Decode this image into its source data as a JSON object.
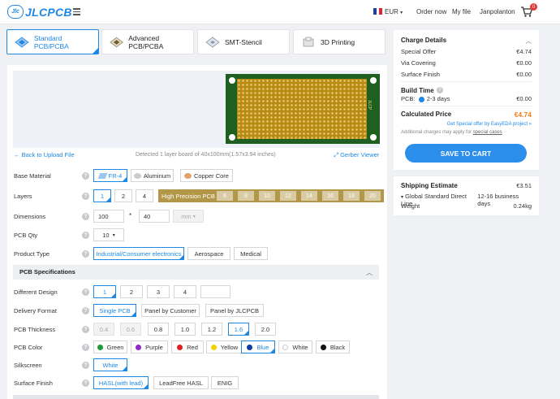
{
  "header": {
    "logo_badge": "Jlc",
    "logo_text": "JLCPCB",
    "currency": "EUR",
    "order_now": "Order now",
    "my_file": "My file",
    "username": "Janpolanton",
    "cart_count": "0"
  },
  "tabs": [
    {
      "label": "Standard PCB/PCBA"
    },
    {
      "label": "Advanced PCB/PCBA"
    },
    {
      "label": "SMT-Stencil"
    },
    {
      "label": "3D Printing"
    }
  ],
  "upload": {
    "back_label": "Back to Upload File",
    "detected": "Detected 1 layer board of 40x100mm(1.57x3.94 inches)",
    "gerber_viewer": "Gerber Viewer",
    "board_mark": "JLCP"
  },
  "base_material": {
    "label": "Base Material",
    "options": [
      "FR-4",
      "Aluminum",
      "Copper Core"
    ]
  },
  "layers": {
    "label": "Layers",
    "options": [
      "1",
      "2",
      "4"
    ],
    "high_precision_label": "High Precision PCB",
    "high_precision_options": [
      "6",
      "8",
      "10",
      "12",
      "14",
      "16",
      "18",
      "20"
    ]
  },
  "dimensions": {
    "label": "Dimensions",
    "width": "100",
    "separator": "*",
    "height": "40",
    "unit": "mm"
  },
  "pcb_qty": {
    "label": "PCB Qty",
    "value": "10"
  },
  "product_type": {
    "label": "Product Type",
    "options": [
      "Industrial/Consumer electronics",
      "Aerospace",
      "Medical"
    ]
  },
  "specs": {
    "title": "PCB Specifications",
    "different_design": {
      "label": "Different Design",
      "options": [
        "1",
        "2",
        "3",
        "4",
        ""
      ]
    },
    "delivery_format": {
      "label": "Delivery Format",
      "options": [
        "Single PCB",
        "Panel by Customer",
        "Panel by JLCPCB"
      ]
    },
    "thickness": {
      "label": "PCB Thickness",
      "options": [
        "0.4",
        "0.6",
        "0.8",
        "1.0",
        "1.2",
        "1.6",
        "2.0"
      ]
    },
    "color": {
      "label": "PCB Color",
      "options": [
        {
          "name": "Green",
          "hex": "#1e9b3a"
        },
        {
          "name": "Purple",
          "hex": "#8e2bc9"
        },
        {
          "name": "Red",
          "hex": "#e02020"
        },
        {
          "name": "Yellow",
          "hex": "#f2d200"
        },
        {
          "name": "Blue",
          "hex": "#0d3f9e"
        },
        {
          "name": "White",
          "hex": "#ffffff"
        },
        {
          "name": "Black",
          "hex": "#111111"
        }
      ]
    },
    "silkscreen": {
      "label": "Silkscreen",
      "value": "White"
    },
    "surface_finish": {
      "label": "Surface Finish",
      "options": [
        "HASL(with lead)",
        "LeadFree HASL",
        "ENIG"
      ]
    }
  },
  "charge": {
    "title": "Charge Details",
    "lines": [
      {
        "label": "Special Offer",
        "value": "€4.74"
      },
      {
        "label": "Via Covering",
        "value": "€0.00"
      },
      {
        "label": "Surface Finish",
        "value": "€0.00"
      }
    ],
    "build_time_label": "Build Time",
    "pcb_label": "PCB:",
    "build_days": "2-3 days",
    "build_price": "€0.00",
    "calculated_label": "Calculated Price",
    "calculated_value": "€4.74",
    "easyeda_link": "Get Special offer by EasyEDA project »",
    "additional_note": "Additional charges may apply for",
    "special_cases": "special cases",
    "save_to_cart": "SAVE TO CART"
  },
  "shipping": {
    "title": "Shipping Estimate",
    "price": "€3.51",
    "method": "Global Standard Direct Line",
    "days": "12-16 business days",
    "weight_label": "Weight",
    "weight_value": "0.24kg"
  },
  "colors": {
    "accent": "#1e88e5",
    "price": "#f07f1c",
    "hp_gold": "#b39748"
  }
}
